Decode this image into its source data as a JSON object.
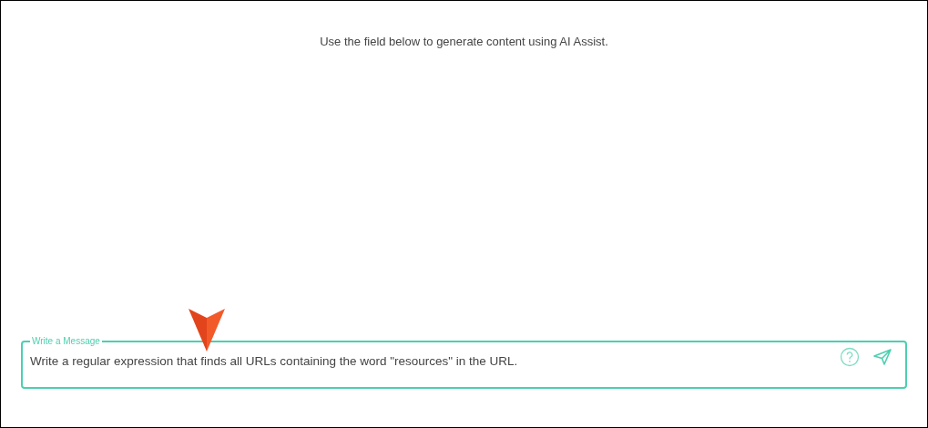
{
  "hint": "Use the field below to generate content using AI Assist.",
  "message_field": {
    "label": "Write a Message",
    "value": "Write a regular expression that finds all URLs containing the word \"resources\" in the URL."
  }
}
